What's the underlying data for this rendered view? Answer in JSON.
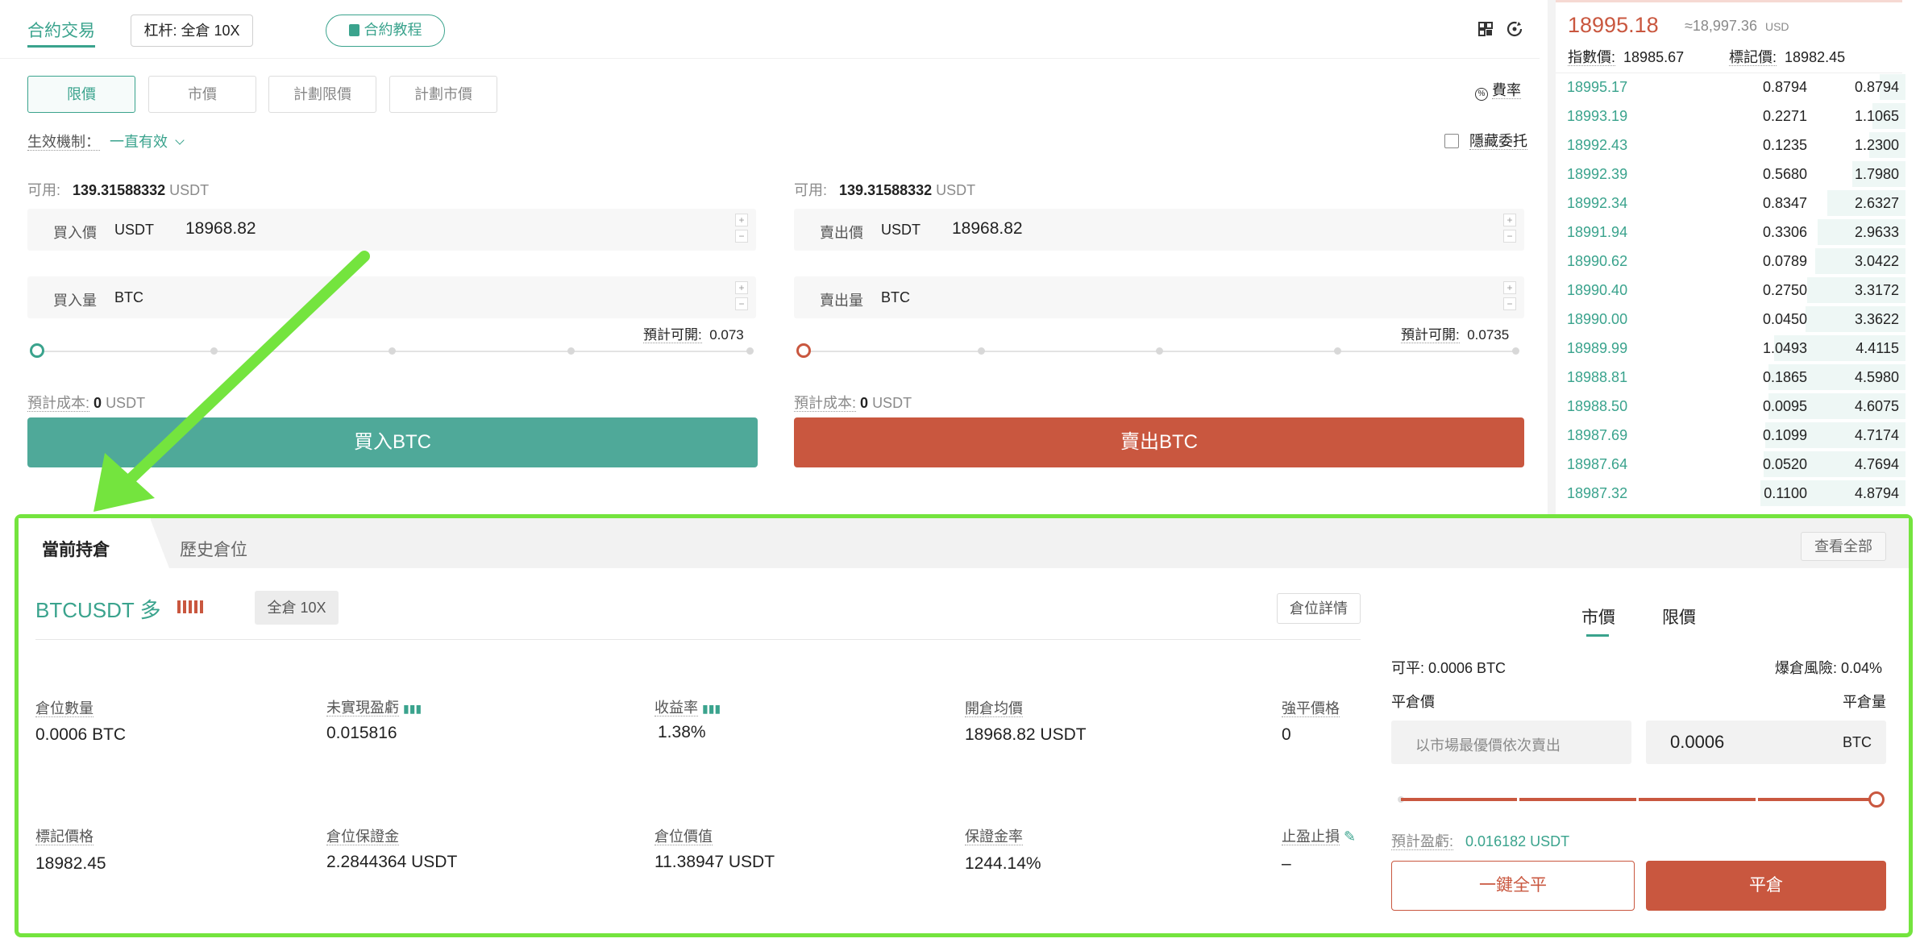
{
  "header": {
    "tab_label": "合約交易",
    "leverage_label": "杠杆: 全倉 10X",
    "tutorial_label": "合約教程"
  },
  "order_types": [
    "限價",
    "市價",
    "計劃限價",
    "計劃市價"
  ],
  "fee_label": "費率",
  "validity": {
    "label": "生效機制：",
    "value": "一直有效"
  },
  "hide_order_label": "隱藏委托",
  "buy": {
    "avail_label": "可用:",
    "avail_value": "139.31588332",
    "avail_unit": "USDT",
    "price_label": "買入價",
    "price_unit": "USDT",
    "price_value": "18968.82",
    "qty_label": "買入量",
    "qty_unit": "BTC",
    "est_label": "預計可開:",
    "est_value": "0.073",
    "cost_label": "預計成本:",
    "cost_value": "0",
    "cost_unit": "USDT",
    "button_label": "買入BTC"
  },
  "sell": {
    "avail_label": "可用:",
    "avail_value": "139.31588332",
    "avail_unit": "USDT",
    "price_label": "賣出價",
    "price_unit": "USDT",
    "price_value": "18968.82",
    "qty_label": "賣出量",
    "qty_unit": "BTC",
    "est_label": "預計可開:",
    "est_value": "0.0735",
    "cost_label": "預計成本:",
    "cost_value": "0",
    "cost_unit": "USDT",
    "button_label": "賣出BTC"
  },
  "orderbook": {
    "last_price": "18995.18",
    "approx": "≈18,997.36",
    "approx_unit": "USD",
    "index_label": "指數價:",
    "index_value": "18985.67",
    "mark_label": "標記價:",
    "mark_value": "18982.45",
    "rows": [
      {
        "price": "18995.17",
        "amount": "0.8794",
        "sum": "0.8794"
      },
      {
        "price": "18993.19",
        "amount": "0.2271",
        "sum": "1.1065"
      },
      {
        "price": "18992.43",
        "amount": "0.1235",
        "sum": "1.2300"
      },
      {
        "price": "18992.39",
        "amount": "0.5680",
        "sum": "1.7980"
      },
      {
        "price": "18992.34",
        "amount": "0.8347",
        "sum": "2.6327"
      },
      {
        "price": "18991.94",
        "amount": "0.3306",
        "sum": "2.9633"
      },
      {
        "price": "18990.62",
        "amount": "0.0789",
        "sum": "3.0422"
      },
      {
        "price": "18990.40",
        "amount": "0.2750",
        "sum": "3.3172"
      },
      {
        "price": "18990.00",
        "amount": "0.0450",
        "sum": "3.3622"
      },
      {
        "price": "18989.99",
        "amount": "1.0493",
        "sum": "4.4115"
      },
      {
        "price": "18988.81",
        "amount": "0.1865",
        "sum": "4.5980"
      },
      {
        "price": "18988.50",
        "amount": "0.0095",
        "sum": "4.6075"
      },
      {
        "price": "18987.69",
        "amount": "0.1099",
        "sum": "4.7174"
      },
      {
        "price": "18987.64",
        "amount": "0.0520",
        "sum": "4.7694"
      },
      {
        "price": "18987.32",
        "amount": "0.1100",
        "sum": "4.8794"
      }
    ]
  },
  "positions": {
    "tab_current": "當前持倉",
    "tab_history": "歷史倉位",
    "view_all": "查看全部",
    "symbol": "BTCUSDT 多",
    "margin_mode": "全倉  10X",
    "detail_label": "倉位詳情",
    "stats_row1": [
      {
        "label": "倉位數量",
        "value": "0.0006 BTC"
      },
      {
        "label": "未實現盈虧",
        "value": "0.015816"
      },
      {
        "label": "收益率",
        "value": "1.38%"
      },
      {
        "label": "開倉均價",
        "value": "18968.82 USDT"
      },
      {
        "label": "強平價格",
        "value": "0"
      }
    ],
    "stats_row2": [
      {
        "label": "標記價格",
        "value": "18982.45"
      },
      {
        "label": "倉位保證金",
        "value": "2.2844364 USDT"
      },
      {
        "label": "倉位價值",
        "value": "11.38947 USDT"
      },
      {
        "label": "保證金率",
        "value": "1244.14%"
      },
      {
        "label": "止盈止損",
        "value": "–"
      }
    ]
  },
  "close": {
    "tab_market": "市價",
    "tab_limit": "限價",
    "closable": "可平: 0.0006 BTC",
    "liq_risk": "爆倉風險: 0.04%",
    "price_label": "平倉價",
    "qty_label": "平倉量",
    "price_placeholder": "以市場最優價依次賣出",
    "qty_value": "0.0006",
    "qty_unit": "BTC",
    "slider_percent": 100,
    "est_label": "預計盈虧:",
    "est_value": "0.016182 USDT",
    "close_all_label": "一鍵全平",
    "close_label": "平倉"
  }
}
